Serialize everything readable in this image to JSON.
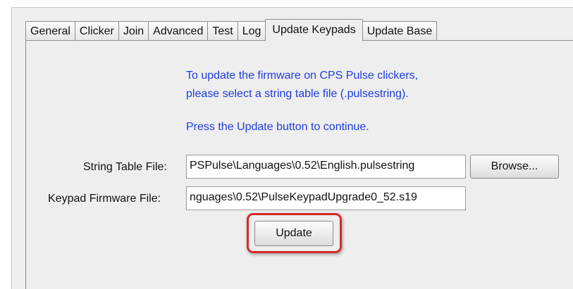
{
  "tabs": [
    {
      "label": "General",
      "selected": false
    },
    {
      "label": "Clicker",
      "selected": false
    },
    {
      "label": "Join",
      "selected": false
    },
    {
      "label": "Advanced",
      "selected": false
    },
    {
      "label": "Test",
      "selected": false
    },
    {
      "label": "Log",
      "selected": false
    },
    {
      "label": "Update Keypads",
      "selected": true
    },
    {
      "label": "Update Base",
      "selected": false
    }
  ],
  "info": {
    "line1": "To update the firmware on CPS Pulse clickers,",
    "line2": "please select a string table file (.pulsestring).",
    "line3": "Press the Update button to continue."
  },
  "fields": {
    "string_table_label": "String Table File:",
    "string_table_value": "PSPulse\\Languages\\0.52\\English.pulsestring",
    "firmware_label": "Keypad Firmware File:",
    "firmware_value": "nguages\\0.52\\PulseKeypadUpgrade0_52.s19"
  },
  "buttons": {
    "browse_label": "Browse...",
    "update_label": "Update"
  },
  "colors": {
    "info_text": "#1f3de0",
    "highlight": "#d42b2b"
  }
}
